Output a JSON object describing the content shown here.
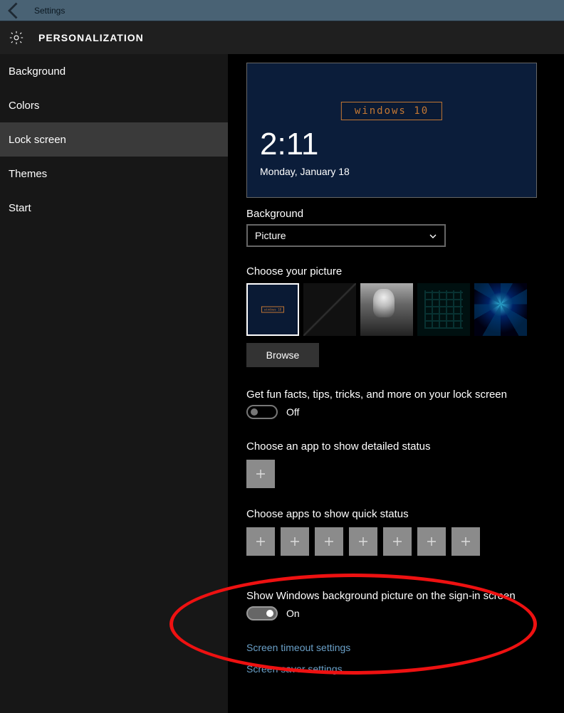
{
  "titlebar": {
    "title": "Settings"
  },
  "header": {
    "title": "PERSONALIZATION"
  },
  "sidebar": {
    "items": [
      {
        "label": "Background",
        "selected": false
      },
      {
        "label": "Colors",
        "selected": false
      },
      {
        "label": "Lock screen",
        "selected": true
      },
      {
        "label": "Themes",
        "selected": false
      },
      {
        "label": "Start",
        "selected": false
      }
    ]
  },
  "preview": {
    "logo_text": "windows 10",
    "time": "2:11",
    "date": "Monday, January 18"
  },
  "background_section": {
    "label": "Background",
    "dropdown_value": "Picture"
  },
  "choose_picture": {
    "label": "Choose your picture",
    "browse_label": "Browse"
  },
  "fun_facts": {
    "label": "Get fun facts, tips, tricks, and more on your lock screen",
    "state": "Off"
  },
  "detailed_status": {
    "label": "Choose an app to show detailed status"
  },
  "quick_status": {
    "label": "Choose apps to show quick status",
    "count": 7
  },
  "show_bg_signin": {
    "label": "Show Windows background picture on the sign-in screen",
    "state": "On"
  },
  "links": {
    "timeout": "Screen timeout settings",
    "saver": "Screen saver settings"
  }
}
